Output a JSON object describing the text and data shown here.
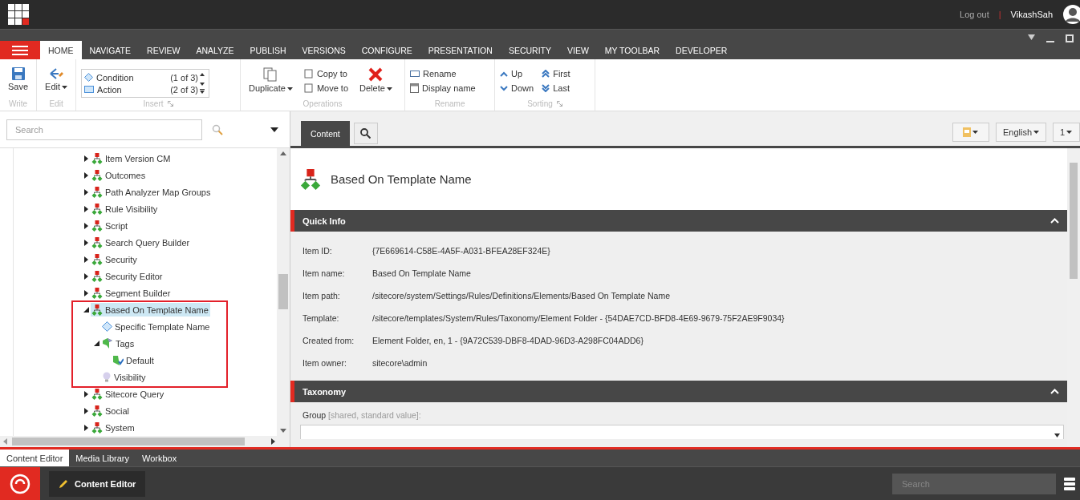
{
  "topbar": {
    "logout": "Log out",
    "separator": "|",
    "user": "VikashSah"
  },
  "ribbon_tabs": [
    {
      "label": "HOME",
      "selected": true
    },
    {
      "label": "NAVIGATE",
      "selected": false
    },
    {
      "label": "REVIEW",
      "selected": false
    },
    {
      "label": "ANALYZE",
      "selected": false
    },
    {
      "label": "PUBLISH",
      "selected": false
    },
    {
      "label": "VERSIONS",
      "selected": false
    },
    {
      "label": "CONFIGURE",
      "selected": false
    },
    {
      "label": "PRESENTATION",
      "selected": false
    },
    {
      "label": "SECURITY",
      "selected": false
    },
    {
      "label": "VIEW",
      "selected": false
    },
    {
      "label": "MY TOOLBAR",
      "selected": false
    },
    {
      "label": "DEVELOPER",
      "selected": false
    }
  ],
  "ribbon": {
    "write": {
      "label": "Write",
      "save": "Save"
    },
    "edit": {
      "label": "Edit",
      "edit": "Edit"
    },
    "insert": {
      "label": "Insert",
      "options": [
        {
          "label": "Condition",
          "count": "(1 of 3)"
        },
        {
          "label": "Action",
          "count": "(2 of 3)"
        }
      ]
    },
    "operations": {
      "label": "Operations",
      "duplicate": "Duplicate",
      "copy_to": "Copy to",
      "move_to": "Move to",
      "delete": "Delete"
    },
    "rename": {
      "label": "Rename",
      "rename": "Rename",
      "display_name": "Display name"
    },
    "sorting": {
      "label": "Sorting",
      "up": "Up",
      "down": "Down",
      "first": "First",
      "last": "Last"
    }
  },
  "tree": {
    "search_placeholder": "Search",
    "items": [
      {
        "label": "Item Version CM",
        "kind": "rule-folder",
        "expanded": false,
        "selected": false
      },
      {
        "label": "Outcomes",
        "kind": "rule-folder",
        "expanded": false,
        "selected": false
      },
      {
        "label": "Path Analyzer Map Groups",
        "kind": "rule-folder",
        "expanded": false,
        "selected": false
      },
      {
        "label": "Rule Visibility",
        "kind": "rule-folder",
        "expanded": false,
        "selected": false
      },
      {
        "label": "Script",
        "kind": "rule-folder",
        "expanded": false,
        "selected": false
      },
      {
        "label": "Search Query Builder",
        "kind": "rule-folder",
        "expanded": false,
        "selected": false
      },
      {
        "label": "Security",
        "kind": "rule-folder",
        "expanded": false,
        "selected": false
      },
      {
        "label": "Security Editor",
        "kind": "rule-folder",
        "expanded": false,
        "selected": false
      },
      {
        "label": "Segment Builder",
        "kind": "rule-folder",
        "expanded": false,
        "selected": false
      },
      {
        "label": "Based On Template Name",
        "kind": "rule-folder",
        "expanded": true,
        "selected": true,
        "annotated": true,
        "children": [
          {
            "label": "Specific Template Name",
            "kind": "condition",
            "selected": false
          },
          {
            "label": "Tags",
            "kind": "tags",
            "expanded": true,
            "selected": false,
            "children": [
              {
                "label": "Default",
                "kind": "tag",
                "selected": false
              }
            ]
          },
          {
            "label": "Visibility",
            "kind": "visibility",
            "selected": false
          }
        ]
      },
      {
        "label": "Sitecore Query",
        "kind": "rule-folder",
        "expanded": false,
        "selected": false
      },
      {
        "label": "Social",
        "kind": "rule-folder",
        "expanded": false,
        "selected": false
      },
      {
        "label": "System",
        "kind": "rule-folder",
        "expanded": false,
        "selected": false
      }
    ]
  },
  "editor": {
    "tabs": [
      {
        "label": "Content",
        "selected": true
      }
    ],
    "language": "English",
    "version": "1",
    "title": "Based On Template Name",
    "sections": [
      {
        "title": "Quick Info",
        "expanded": true,
        "fields": [
          {
            "label": "Item ID:",
            "value": "{7E669614-C58E-4A5F-A031-BFEA28EF324E}"
          },
          {
            "label": "Item name:",
            "value": "Based On Template Name"
          },
          {
            "label": "Item path:",
            "value": "/sitecore/system/Settings/Rules/Definitions/Elements/Based On Template Name"
          },
          {
            "label": "Template:",
            "value": "/sitecore/templates/System/Rules/Taxonomy/Element Folder - {54DAE7CD-BFD8-4E69-9679-75F2AE9F9034}"
          },
          {
            "label": "Created from:",
            "value": "Element Folder, en, 1 - {9A72C539-DBF8-4DAD-96D3-A298FC04ADD6}"
          },
          {
            "label": "Item owner:",
            "value": "sitecore\\admin"
          }
        ]
      },
      {
        "title": "Taxonomy",
        "expanded": true,
        "inputs": [
          {
            "label": "Group",
            "note": "[shared, standard value]:"
          }
        ]
      }
    ]
  },
  "bottom_tabs": [
    {
      "label": "Content Editor",
      "selected": true
    },
    {
      "label": "Media Library",
      "selected": false
    },
    {
      "label": "Workbox",
      "selected": false
    }
  ],
  "taskbar": {
    "app": "Content Editor",
    "search_placeholder": "Search"
  }
}
